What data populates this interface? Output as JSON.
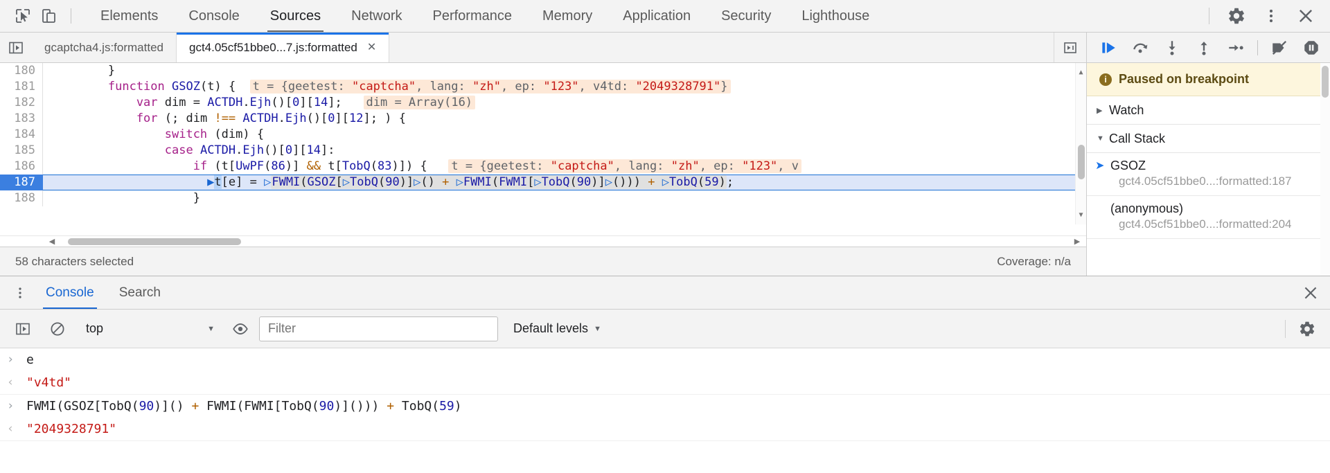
{
  "main_toolbar": {
    "inspect_icon": "inspect-cursor-icon",
    "device_icon": "device-toolbar-icon",
    "tabs": [
      {
        "label": "Elements",
        "selected": false
      },
      {
        "label": "Console",
        "selected": false
      },
      {
        "label": "Sources",
        "selected": true
      },
      {
        "label": "Network",
        "selected": false
      },
      {
        "label": "Performance",
        "selected": false
      },
      {
        "label": "Memory",
        "selected": false
      },
      {
        "label": "Application",
        "selected": false
      },
      {
        "label": "Security",
        "selected": false
      },
      {
        "label": "Lighthouse",
        "selected": false
      }
    ],
    "settings_icon": "gear-icon",
    "more_icon": "kebab-menu-icon",
    "close_icon": "close-icon"
  },
  "file_tabs": {
    "navigator_toggle_icon": "show-navigator-icon",
    "tabs": [
      {
        "label": "gcaptcha4.js:formatted",
        "active": false,
        "closable": false
      },
      {
        "label": "gct4.05cf51bbe0...7.js:formatted",
        "active": true,
        "closable": true
      }
    ],
    "close_label": "✕",
    "more_tabs_icon": "more-tabs-icon"
  },
  "editor": {
    "lines": [
      {
        "number": "180",
        "text": "        }"
      },
      {
        "number": "181",
        "text": "        function GSOZ(t) {  t = {geetest: \"captcha\", lang: \"zh\", ep: \"123\", v4td: \"2049328791\"}"
      },
      {
        "number": "182",
        "text": "            var dim = ACTDH.Ejh()[0][14];   dim = Array(16)"
      },
      {
        "number": "183",
        "text": "            for (; dim !== ACTDH.Ejh()[0][12]; ) {"
      },
      {
        "number": "184",
        "text": "                switch (dim) {"
      },
      {
        "number": "185",
        "text": "                case ACTDH.Ejh()[0][14]:"
      },
      {
        "number": "186",
        "text": "                    if (t[UwPF(86)] && t[TobQ(83)]) {   t = {geetest: \"captcha\", lang: \"zh\", ep: \"123\", v"
      },
      {
        "number": "187",
        "text": "                        t[e] = FWMI(GSOZ[TobQ(90)]() + FWMI(FWMI[TobQ(90)]())) + TobQ(59);",
        "executing": true
      },
      {
        "number": "188",
        "text": "                    }"
      }
    ],
    "inline_hint_181": "t = {geetest: \"captcha\", lang: \"zh\", ep: \"123\", v4td: \"2049328791\"}",
    "inline_hint_182": "dim = Array(16)",
    "inline_hint_186": "t = {geetest: \"captcha\", lang: \"zh\", ep: \"123\", v"
  },
  "editor_status": {
    "selection_text": "58 characters selected",
    "coverage_text": "Coverage: n/a"
  },
  "debugger": {
    "buttons": [
      {
        "name": "resume-script-execution",
        "icon": "resume-icon"
      },
      {
        "name": "step-over-next-function-call",
        "icon": "step-over-icon"
      },
      {
        "name": "step-into-next-function-call",
        "icon": "step-into-icon"
      },
      {
        "name": "step-out-of-current-function",
        "icon": "step-out-icon"
      },
      {
        "name": "step",
        "icon": "step-icon"
      },
      {
        "name": "deactivate-breakpoints",
        "icon": "deactivate-breakpoints-icon"
      },
      {
        "name": "pause-on-exceptions",
        "icon": "pause-on-exceptions-icon"
      }
    ],
    "paused_banner": "Paused on breakpoint",
    "watch_label": "Watch",
    "watch_expanded": false,
    "call_stack_label": "Call Stack",
    "call_stack_expanded": true,
    "call_stack": [
      {
        "name": "GSOZ",
        "location": "gct4.05cf51bbe0...:formatted:187",
        "selected": true
      },
      {
        "name": "(anonymous)",
        "location": "gct4.05cf51bbe0...:formatted:204",
        "selected": false
      }
    ]
  },
  "drawer": {
    "more_icon": "kebab-menu-icon",
    "tabs": [
      {
        "label": "Console",
        "selected": true
      },
      {
        "label": "Search",
        "selected": false
      }
    ],
    "close_icon": "close-icon"
  },
  "console_toolbar": {
    "sidebar_icon": "console-sidebar-icon",
    "clear_icon": "clear-console-icon",
    "context_value": "top",
    "eye_icon": "live-expression-icon",
    "filter_placeholder": "Filter",
    "filter_value": "",
    "levels_label": "Default levels",
    "settings_icon": "gear-icon"
  },
  "console_log": [
    {
      "type": "input",
      "marker": "›",
      "text": "e"
    },
    {
      "type": "output",
      "marker": "‹",
      "text": "\"v4td\""
    },
    {
      "type": "input",
      "marker": "›",
      "text": "FWMI(GSOZ[TobQ(90)]() + FWMI(FWMI[TobQ(90)]())) + TobQ(59)"
    },
    {
      "type": "output",
      "marker": "‹",
      "text": "\"2049328791\""
    }
  ],
  "colors": {
    "accent": "#1a73e8",
    "toolbar_bg": "#f3f3f3",
    "exec_line_bg": "#dde6f9",
    "hint_bg": "#fde8d7",
    "paused_bg": "#fdf6dd",
    "string_color": "#c41a16",
    "number_color": "#1a1aa6",
    "keyword_color": "#a52089"
  }
}
